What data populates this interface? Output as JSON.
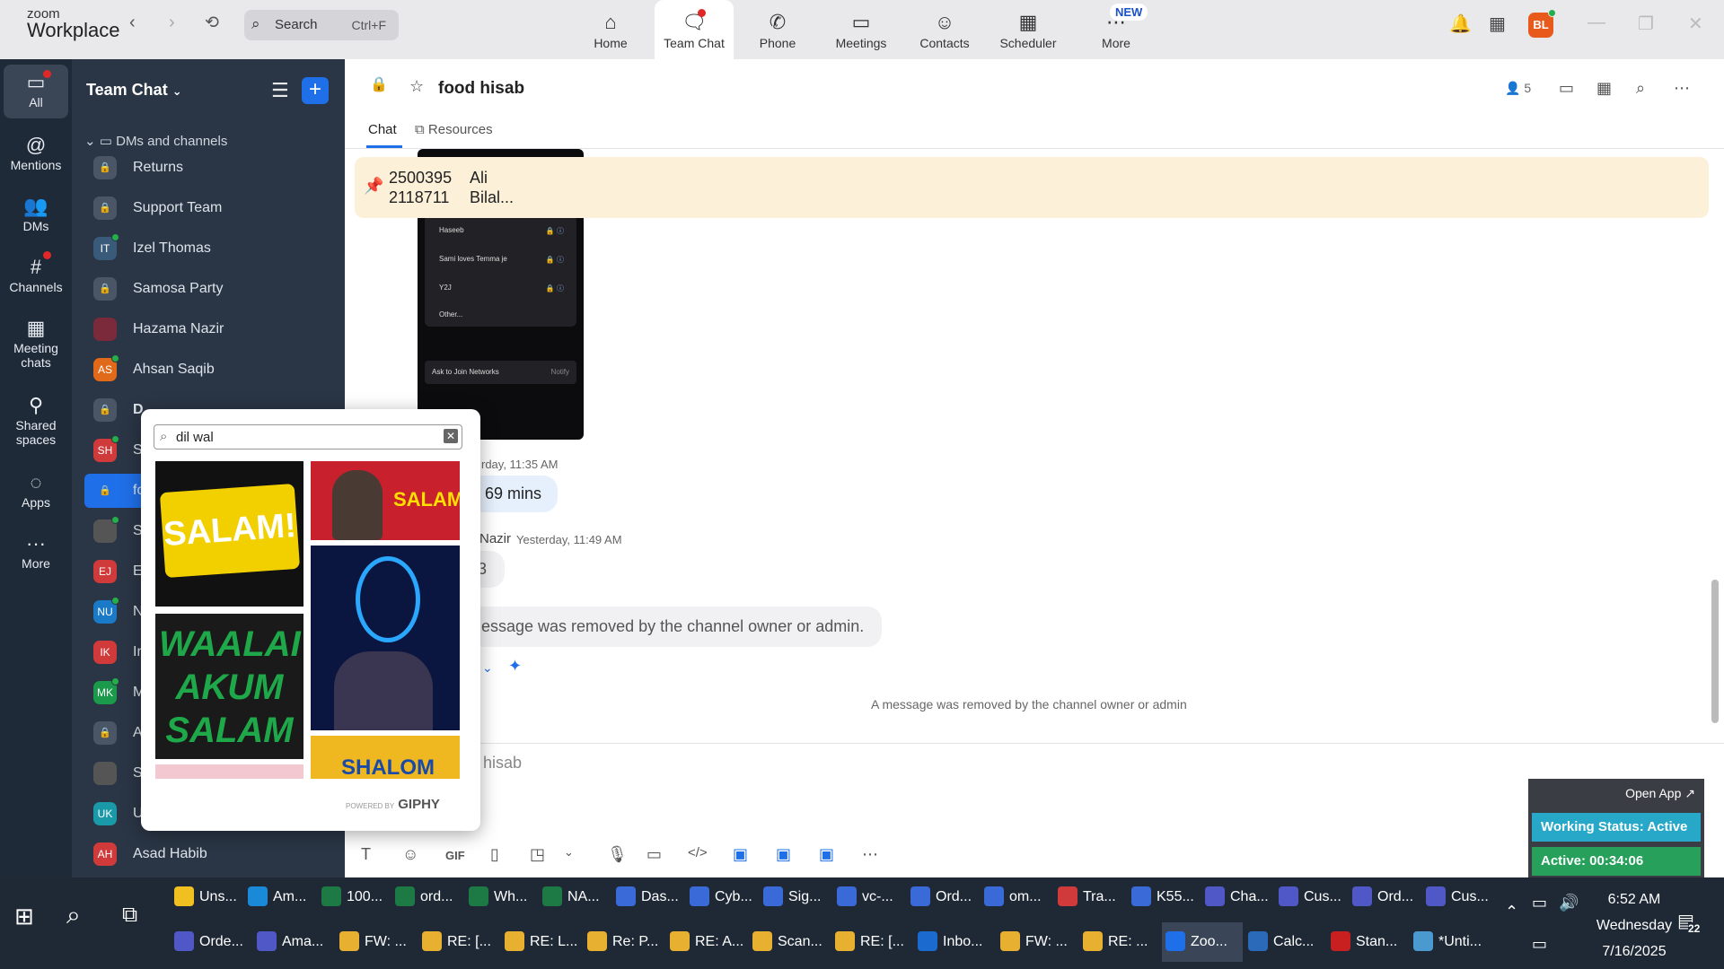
{
  "app": {
    "logo_top": "zoom",
    "logo_bottom": "Workplace"
  },
  "search": {
    "label": "Search",
    "shortcut": "Ctrl+F"
  },
  "top_tabs": [
    {
      "label": "Home",
      "icon": "home-icon"
    },
    {
      "label": "Team Chat",
      "icon": "chat-icon"
    },
    {
      "label": "Phone",
      "icon": "phone-icon"
    },
    {
      "label": "Meetings",
      "icon": "video-icon"
    },
    {
      "label": "Contacts",
      "icon": "contacts-icon"
    },
    {
      "label": "Scheduler",
      "icon": "calendar-icon"
    },
    {
      "label": "More",
      "icon": "more-icon"
    }
  ],
  "new_badge": "NEW",
  "avatar": {
    "initials": "BL",
    "color": "#e85a1c"
  },
  "rail": [
    {
      "label": "All"
    },
    {
      "label": "Mentions"
    },
    {
      "label": "DMs"
    },
    {
      "label": "Channels"
    },
    {
      "label": "Meeting chats"
    },
    {
      "label": "Shared spaces"
    },
    {
      "label": "Apps"
    },
    {
      "label": "More"
    }
  ],
  "sidebar": {
    "title": "Team Chat",
    "section": "DMs and channels",
    "rows": [
      {
        "name": "Returns",
        "initials": "",
        "color": "#4a5566"
      },
      {
        "name": "Support Team",
        "initials": "",
        "color": "#4a5566"
      },
      {
        "name": "Izel Thomas",
        "initials": "IT",
        "color": "#3a5a7a"
      },
      {
        "name": "Samosa Party",
        "initials": "",
        "color": "#4a5566"
      },
      {
        "name": "Hazama Nazir",
        "initials": "",
        "color": "#7a2a3a"
      },
      {
        "name": "Ahsan Saqib",
        "initials": "AS",
        "color": "#e06a1a"
      },
      {
        "name": "D",
        "initials": "",
        "color": "#4a5566"
      },
      {
        "name": "S",
        "initials": "SH",
        "color": "#d03a3a"
      },
      {
        "name": "fo",
        "initials": "",
        "color": "#1f6fe8"
      },
      {
        "name": "S",
        "initials": "",
        "color": "#555"
      },
      {
        "name": "E",
        "initials": "EJ",
        "color": "#d03a3a"
      },
      {
        "name": "N",
        "initials": "NU",
        "color": "#1a7ac8"
      },
      {
        "name": "Ir",
        "initials": "IK",
        "color": "#d03a3a"
      },
      {
        "name": "M",
        "initials": "MK",
        "color": "#1a9a4a"
      },
      {
        "name": "A",
        "initials": "",
        "color": "#4a5566"
      },
      {
        "name": "S",
        "initials": "",
        "color": "#555"
      },
      {
        "name": "U",
        "initials": "UK",
        "color": "#1a9aa8"
      },
      {
        "name": "Asad Habib",
        "initials": "AH",
        "color": "#d03a3a"
      }
    ]
  },
  "channel": {
    "name": "food hisab",
    "member_count": "5",
    "tabs": [
      "Chat",
      "Resources"
    ]
  },
  "pinned": {
    "line1a": "2500395",
    "line1b": "Ali",
    "line2a": "2118711",
    "line2b": "Bilal..."
  },
  "phone_screenshot": {
    "items": [
      "Haseeb",
      "Sami loves Temma je",
      "Y2J",
      "Other..."
    ],
    "ask": "Ask to Join Networks",
    "notify": "Notify"
  },
  "messages": {
    "meta1": "rday, 11:35 AM",
    "bubble1": "69 mins",
    "meta2_name": "Nazir",
    "meta2_time": "Yesterday, 11:49 AM",
    "bubble2": "3",
    "bubble3": "essage was removed by the channel owner or admin.",
    "system": "A message was removed by the channel owner or admin"
  },
  "composer": {
    "placeholder": "hisab"
  },
  "gif_picker": {
    "query": "dil wal",
    "powered": "POWERED BY",
    "brand": "GIPHY",
    "tile1": "SALAM!",
    "tile2": "SALAM",
    "tile3": "WAALAI AKUM SALAM",
    "tile5": "SHALOM"
  },
  "status_widget": {
    "open_app": "Open App ↗",
    "working": "Working Status: Active",
    "active": "Active: 00:34:06"
  },
  "taskbar": {
    "row1": [
      "Uns...",
      "Am...",
      "100...",
      "ord...",
      "Wh...",
      "NA...",
      "Das...",
      "Cyb...",
      "Sig...",
      "vc-...",
      "Ord...",
      "om...",
      "Tra...",
      "K55...",
      "Cha...",
      "Cus...",
      "Ord...",
      "Cus..."
    ],
    "row2": [
      "Orde...",
      "Ama...",
      "FW: ...",
      "RE: [...",
      "RE: L...",
      "Re: P...",
      "RE: A...",
      "Scan...",
      "RE: [...",
      "Inbo...",
      "FW: ...",
      "RE: ...",
      "Zoo...",
      "Calc...",
      "Stan...",
      "*Unti..."
    ],
    "time": "6:52 AM",
    "day": "Wednesday",
    "date": "7/16/2025",
    "notif_count": "22"
  }
}
